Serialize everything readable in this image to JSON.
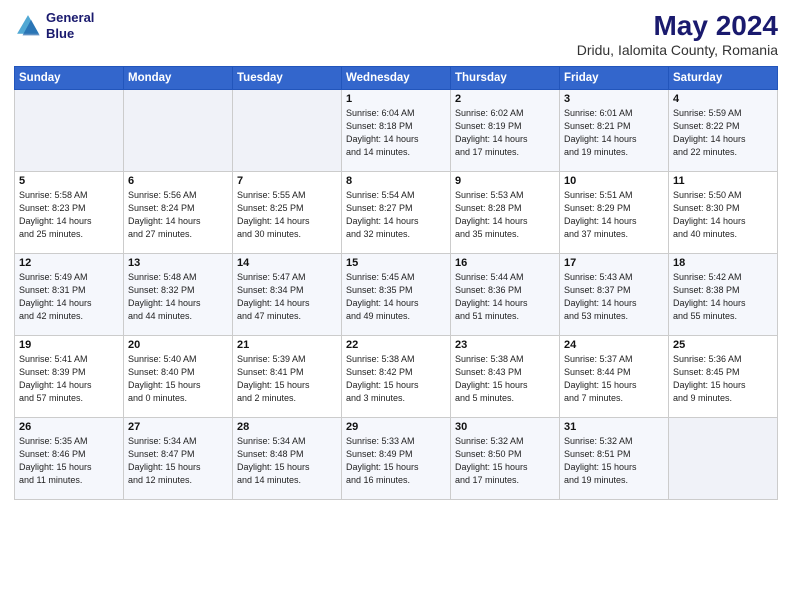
{
  "header": {
    "logo_line1": "General",
    "logo_line2": "Blue",
    "title": "May 2024",
    "subtitle": "Dridu, Ialomita County, Romania"
  },
  "weekdays": [
    "Sunday",
    "Monday",
    "Tuesday",
    "Wednesday",
    "Thursday",
    "Friday",
    "Saturday"
  ],
  "weeks": [
    [
      {
        "num": "",
        "detail": ""
      },
      {
        "num": "",
        "detail": ""
      },
      {
        "num": "",
        "detail": ""
      },
      {
        "num": "1",
        "detail": "Sunrise: 6:04 AM\nSunset: 8:18 PM\nDaylight: 14 hours\nand 14 minutes."
      },
      {
        "num": "2",
        "detail": "Sunrise: 6:02 AM\nSunset: 8:19 PM\nDaylight: 14 hours\nand 17 minutes."
      },
      {
        "num": "3",
        "detail": "Sunrise: 6:01 AM\nSunset: 8:21 PM\nDaylight: 14 hours\nand 19 minutes."
      },
      {
        "num": "4",
        "detail": "Sunrise: 5:59 AM\nSunset: 8:22 PM\nDaylight: 14 hours\nand 22 minutes."
      }
    ],
    [
      {
        "num": "5",
        "detail": "Sunrise: 5:58 AM\nSunset: 8:23 PM\nDaylight: 14 hours\nand 25 minutes."
      },
      {
        "num": "6",
        "detail": "Sunrise: 5:56 AM\nSunset: 8:24 PM\nDaylight: 14 hours\nand 27 minutes."
      },
      {
        "num": "7",
        "detail": "Sunrise: 5:55 AM\nSunset: 8:25 PM\nDaylight: 14 hours\nand 30 minutes."
      },
      {
        "num": "8",
        "detail": "Sunrise: 5:54 AM\nSunset: 8:27 PM\nDaylight: 14 hours\nand 32 minutes."
      },
      {
        "num": "9",
        "detail": "Sunrise: 5:53 AM\nSunset: 8:28 PM\nDaylight: 14 hours\nand 35 minutes."
      },
      {
        "num": "10",
        "detail": "Sunrise: 5:51 AM\nSunset: 8:29 PM\nDaylight: 14 hours\nand 37 minutes."
      },
      {
        "num": "11",
        "detail": "Sunrise: 5:50 AM\nSunset: 8:30 PM\nDaylight: 14 hours\nand 40 minutes."
      }
    ],
    [
      {
        "num": "12",
        "detail": "Sunrise: 5:49 AM\nSunset: 8:31 PM\nDaylight: 14 hours\nand 42 minutes."
      },
      {
        "num": "13",
        "detail": "Sunrise: 5:48 AM\nSunset: 8:32 PM\nDaylight: 14 hours\nand 44 minutes."
      },
      {
        "num": "14",
        "detail": "Sunrise: 5:47 AM\nSunset: 8:34 PM\nDaylight: 14 hours\nand 47 minutes."
      },
      {
        "num": "15",
        "detail": "Sunrise: 5:45 AM\nSunset: 8:35 PM\nDaylight: 14 hours\nand 49 minutes."
      },
      {
        "num": "16",
        "detail": "Sunrise: 5:44 AM\nSunset: 8:36 PM\nDaylight: 14 hours\nand 51 minutes."
      },
      {
        "num": "17",
        "detail": "Sunrise: 5:43 AM\nSunset: 8:37 PM\nDaylight: 14 hours\nand 53 minutes."
      },
      {
        "num": "18",
        "detail": "Sunrise: 5:42 AM\nSunset: 8:38 PM\nDaylight: 14 hours\nand 55 minutes."
      }
    ],
    [
      {
        "num": "19",
        "detail": "Sunrise: 5:41 AM\nSunset: 8:39 PM\nDaylight: 14 hours\nand 57 minutes."
      },
      {
        "num": "20",
        "detail": "Sunrise: 5:40 AM\nSunset: 8:40 PM\nDaylight: 15 hours\nand 0 minutes."
      },
      {
        "num": "21",
        "detail": "Sunrise: 5:39 AM\nSunset: 8:41 PM\nDaylight: 15 hours\nand 2 minutes."
      },
      {
        "num": "22",
        "detail": "Sunrise: 5:38 AM\nSunset: 8:42 PM\nDaylight: 15 hours\nand 3 minutes."
      },
      {
        "num": "23",
        "detail": "Sunrise: 5:38 AM\nSunset: 8:43 PM\nDaylight: 15 hours\nand 5 minutes."
      },
      {
        "num": "24",
        "detail": "Sunrise: 5:37 AM\nSunset: 8:44 PM\nDaylight: 15 hours\nand 7 minutes."
      },
      {
        "num": "25",
        "detail": "Sunrise: 5:36 AM\nSunset: 8:45 PM\nDaylight: 15 hours\nand 9 minutes."
      }
    ],
    [
      {
        "num": "26",
        "detail": "Sunrise: 5:35 AM\nSunset: 8:46 PM\nDaylight: 15 hours\nand 11 minutes."
      },
      {
        "num": "27",
        "detail": "Sunrise: 5:34 AM\nSunset: 8:47 PM\nDaylight: 15 hours\nand 12 minutes."
      },
      {
        "num": "28",
        "detail": "Sunrise: 5:34 AM\nSunset: 8:48 PM\nDaylight: 15 hours\nand 14 minutes."
      },
      {
        "num": "29",
        "detail": "Sunrise: 5:33 AM\nSunset: 8:49 PM\nDaylight: 15 hours\nand 16 minutes."
      },
      {
        "num": "30",
        "detail": "Sunrise: 5:32 AM\nSunset: 8:50 PM\nDaylight: 15 hours\nand 17 minutes."
      },
      {
        "num": "31",
        "detail": "Sunrise: 5:32 AM\nSunset: 8:51 PM\nDaylight: 15 hours\nand 19 minutes."
      },
      {
        "num": "",
        "detail": ""
      }
    ]
  ]
}
